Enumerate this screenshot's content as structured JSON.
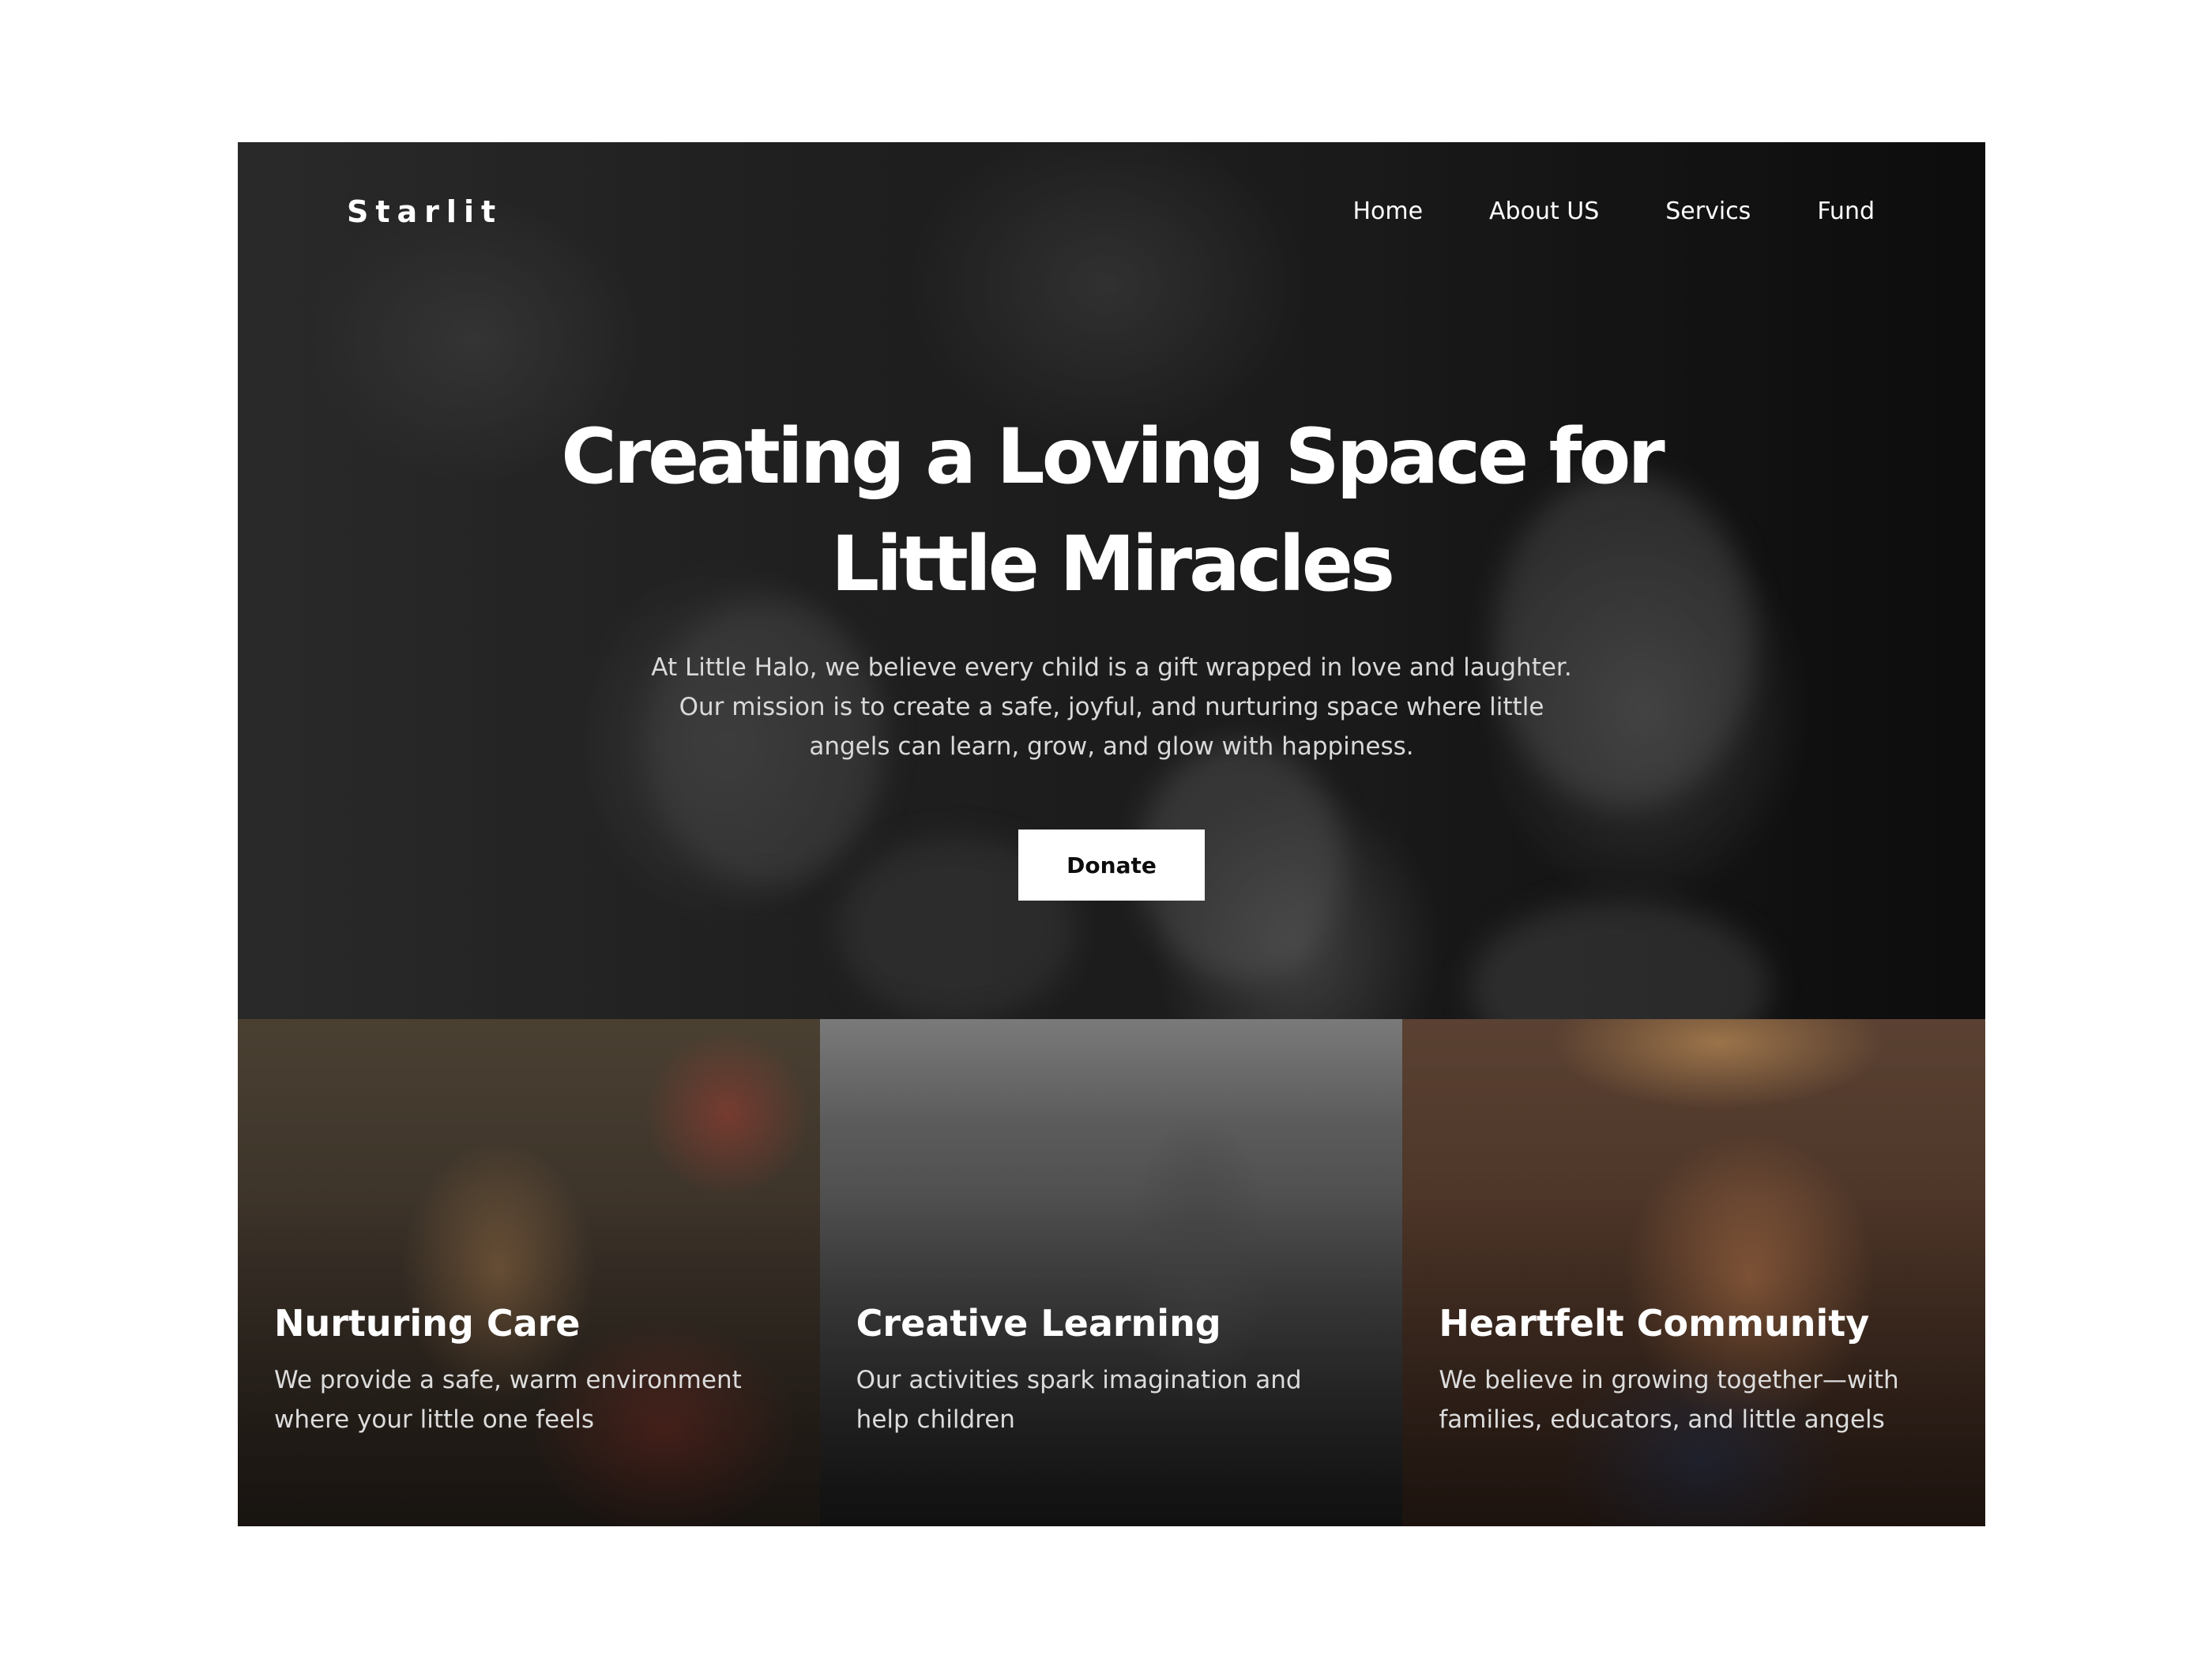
{
  "brand": {
    "logo_text": "Starlit"
  },
  "nav": {
    "items": [
      {
        "label": "Home"
      },
      {
        "label": "About US"
      },
      {
        "label": "Servics"
      },
      {
        "label": "Fund"
      }
    ]
  },
  "hero": {
    "title": "Creating a Loving Space for Little Miracles",
    "description": "At Little Halo, we believe every child is a gift wrapped in love and laughter. Our mission is to create a safe, joyful, and nurturing space where little angels can learn, grow, and glow with happiness.",
    "cta_label": "Donate"
  },
  "cards": [
    {
      "title": "Nurturing Care",
      "description": "We provide a safe, warm environment where your little one feels"
    },
    {
      "title": "Creative Learning",
      "description": "Our activities spark imagination and help children"
    },
    {
      "title": "Heartfelt Community",
      "description": "We believe in growing together—with families, educators, and little angels"
    }
  ],
  "colors": {
    "button_background": "#ffffff",
    "button_text": "#0d0d0d",
    "text_primary": "#ffffff",
    "text_secondary": "#d9d9d9"
  }
}
